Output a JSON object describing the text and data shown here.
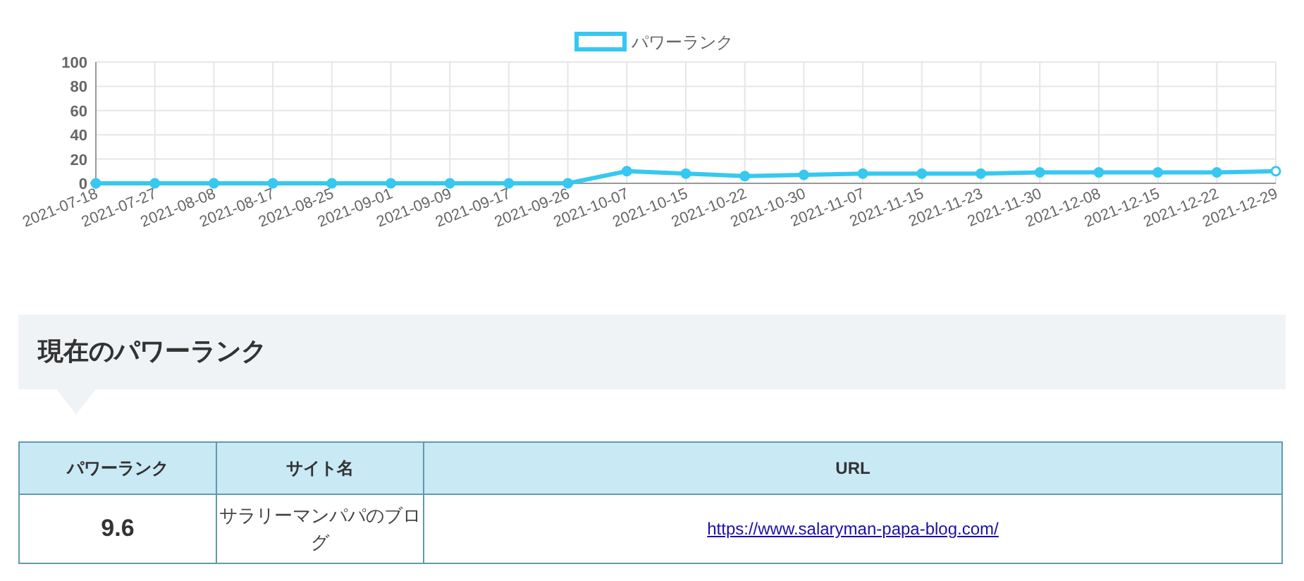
{
  "chart": {
    "chart_data": {
      "type": "line",
      "categories": [
        "2021-07-18",
        "2021-07-27",
        "2021-08-08",
        "2021-08-17",
        "2021-08-25",
        "2021-09-01",
        "2021-09-09",
        "2021-09-17",
        "2021-09-26",
        "2021-10-07",
        "2021-10-15",
        "2021-10-22",
        "2021-10-30",
        "2021-11-07",
        "2021-11-15",
        "2021-11-23",
        "2021-11-30",
        "2021-12-08",
        "2021-12-15",
        "2021-12-22",
        "2021-12-29"
      ],
      "series": [
        {
          "name": "パワーランク",
          "color": "#36c8f0",
          "marker": true,
          "values": [
            0,
            0,
            0,
            0,
            0,
            0,
            0,
            0,
            0,
            10,
            8,
            6,
            7,
            8,
            8,
            8,
            9,
            9,
            9,
            9,
            10
          ]
        }
      ],
      "grid": true,
      "ylim": [
        0,
        100
      ],
      "yticks": [
        0,
        20,
        40,
        60,
        80,
        100
      ]
    }
  },
  "section": {
    "heading": "現在のパワーランク"
  },
  "table": {
    "columns": [
      "パワーランク",
      "サイト名",
      "URL"
    ],
    "rows": [
      {
        "rank": "9.6",
        "site": "サラリーマンパパのブログ",
        "url": "https://www.salaryman-papa-blog.com/"
      }
    ]
  }
}
